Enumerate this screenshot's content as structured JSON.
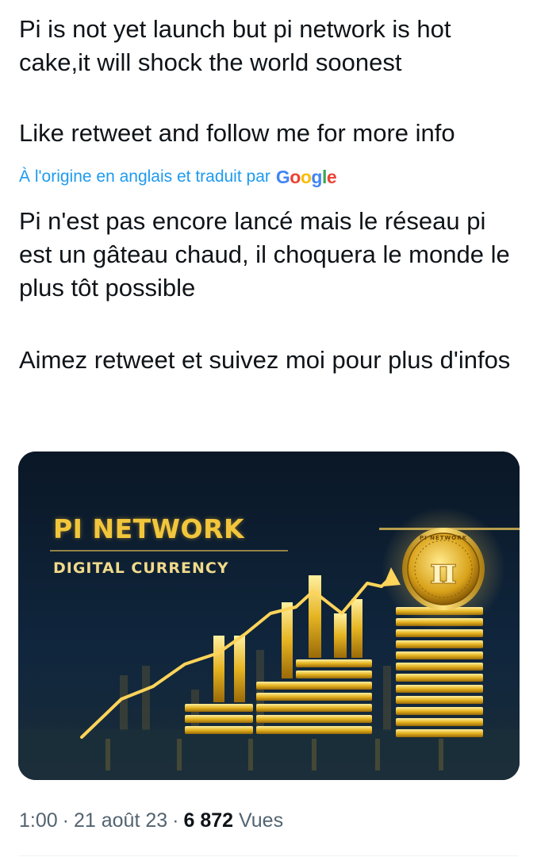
{
  "tweet": {
    "original_line1": "Pi is not yet launch but pi network is hot cake,it will shock the world soonest",
    "original_line2": "Like retweet and follow me for more info",
    "translated_notice": "À l'origine en anglais et traduit par",
    "translator_brand": "Google",
    "translated_line1": "Pi n'est pas encore lancé mais le réseau pi est un gâteau chaud, il choquera le monde le plus tôt possible",
    "translated_line2": "Aimez retweet et suivez moi pour plus d'infos"
  },
  "media": {
    "title": "PI NETWORK",
    "subtitle": "DIGITAL CURRENCY",
    "coin_symbol": "π",
    "coin_ring_text": "PI NETWORK",
    "colors": {
      "gold": "#f2c63c",
      "background": "#0b1a2b"
    }
  },
  "meta": {
    "time": "1:00",
    "date": "21 août 23",
    "views_count": "6 872",
    "views_label": "Vues",
    "separator": "·"
  },
  "colors": {
    "text": "#0f1419",
    "link": "#1d9bf0",
    "secondary": "#536471"
  }
}
